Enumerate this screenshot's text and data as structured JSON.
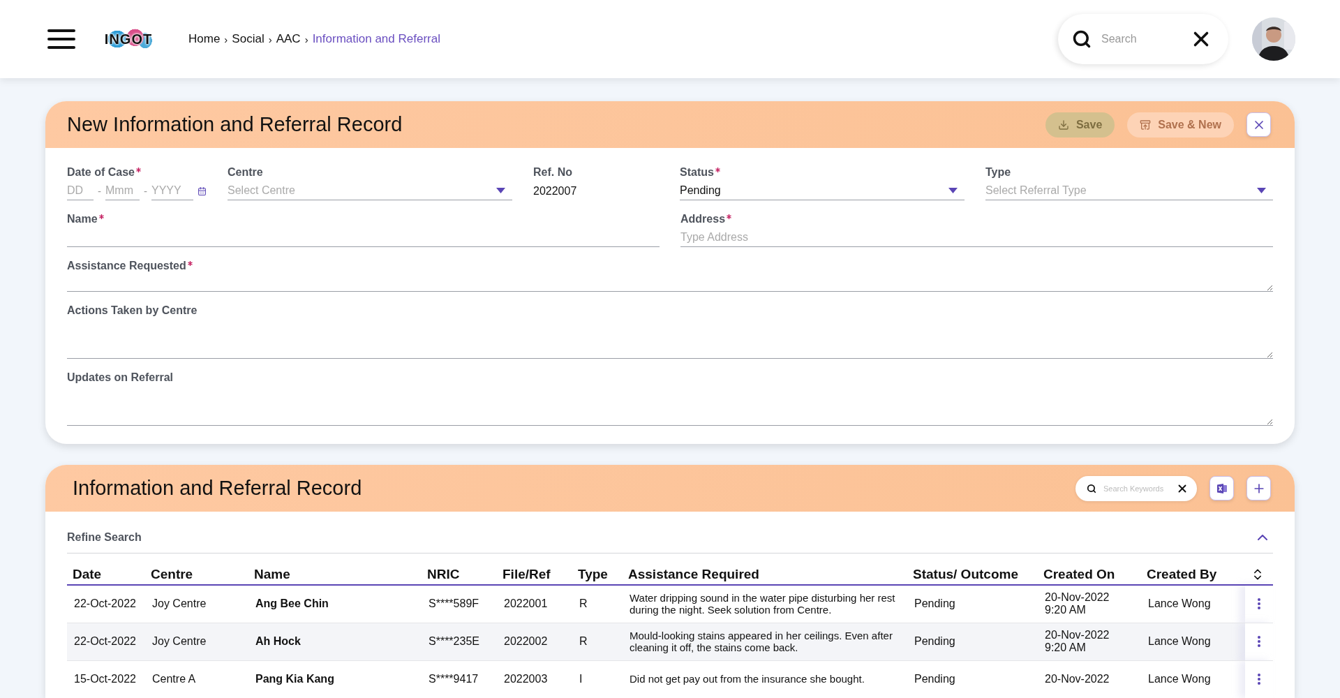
{
  "header": {
    "logo": "INGOT",
    "breadcrumb": [
      {
        "label": "Home",
        "separator": "›",
        "current": false
      },
      {
        "label": "Social",
        "separator": "›",
        "current": false
      },
      {
        "label": "AAC",
        "separator": "›",
        "current": false
      },
      {
        "label": "Information and Referral",
        "current": true
      }
    ],
    "search": {
      "placeholder": "Search"
    }
  },
  "form": {
    "title": "New Information and Referral Record",
    "buttons": [
      {
        "kind": "save",
        "label": "Save",
        "disabled": true
      },
      {
        "kind": "save_new",
        "label": "Save & New",
        "disabled": true
      }
    ],
    "field_rows": [
      [
        {
          "kind": "date",
          "label": "Date of Case",
          "required": true,
          "parts": [
            {
              "placeholder": "DD",
              "separator": "-"
            },
            {
              "placeholder": "Mmm",
              "separator": "-"
            },
            {
              "placeholder": "YYYY"
            }
          ]
        },
        {
          "kind": "select",
          "label": "Centre",
          "required": false,
          "placeholder": "Select Centre"
        },
        {
          "kind": "static",
          "label": "Ref. No",
          "required": false,
          "value": "2022007"
        },
        {
          "kind": "select",
          "label": "Status",
          "required": true,
          "value": "Pending"
        },
        {
          "kind": "select",
          "label": "Type",
          "required": false,
          "placeholder": "Select Referral Type"
        }
      ],
      [
        {
          "kind": "text",
          "label": "Name",
          "required": true
        },
        {
          "kind": "text",
          "label": "Address",
          "required": true,
          "placeholder": "Type Address"
        }
      ],
      [
        {
          "kind": "textarea",
          "label": "Assistance Requested",
          "required": true,
          "tall": false
        }
      ],
      [
        {
          "kind": "textarea",
          "label": "Actions Taken by Centre",
          "required": false,
          "tall": true
        }
      ],
      [
        {
          "kind": "textarea",
          "label": "Updates on Referral",
          "required": false,
          "tall": true
        }
      ]
    ]
  },
  "records": {
    "title": "Information and Referral Record",
    "search": {
      "placeholder": "Search Keywords"
    },
    "refine": {
      "label": "Refine Search",
      "expanded": true
    },
    "columns": [
      {
        "label": "Date",
        "kind": "plain"
      },
      {
        "label": "Centre",
        "kind": "plain"
      },
      {
        "label": "Name",
        "kind": "name"
      },
      {
        "label": "NRIC",
        "kind": "plain"
      },
      {
        "label": "File/Ref",
        "kind": "plain"
      },
      {
        "label": "Type",
        "kind": "plain"
      },
      {
        "label": "Assistance Required",
        "kind": "text"
      },
      {
        "label": "Status/ Outcome",
        "kind": "plain"
      },
      {
        "label": "Created On",
        "kind": "plain"
      },
      {
        "label": "Created By",
        "kind": "plain"
      }
    ],
    "rows": [
      [
        "22-Oct-2022",
        "Joy Centre",
        "Ang Bee Chin",
        "S****589F",
        "2022001",
        "R",
        "Water dripping sound in the water pipe disturbing her rest during the night. Seek solution from Centre.",
        "Pending",
        "20-Nov-2022 9:20 AM",
        "Lance Wong"
      ],
      [
        "22-Oct-2022",
        "Joy Centre",
        "Ah Hock",
        "S****235E",
        "2022002",
        "R",
        "Mould-looking stains appeared in her ceilings. Even after cleaning it off, the stains come back.",
        "Pending",
        "20-Nov-2022 9:20 AM",
        "Lance Wong"
      ],
      [
        "15-Oct-2022",
        "Centre A",
        "Pang Kia Kang",
        "S****9417",
        "2022003",
        "I",
        "Did not get pay out from the insurance she bought.",
        "Pending",
        "20-Nov-2022",
        "Lance Wong"
      ]
    ]
  }
}
